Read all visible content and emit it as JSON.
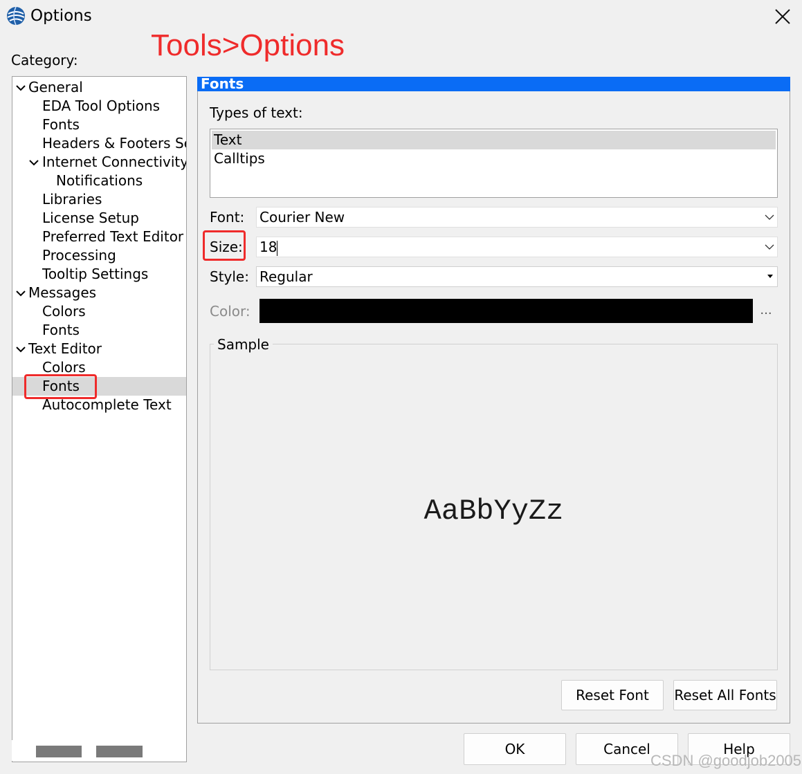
{
  "window": {
    "title": "Options",
    "icon": "app-globe-icon"
  },
  "annotation": {
    "title": "Tools>Options",
    "color": "#ef2b2b"
  },
  "category": {
    "label": "Category:",
    "items": [
      {
        "label": "General",
        "expanded": true
      },
      {
        "label": "EDA Tool Options"
      },
      {
        "label": "Fonts"
      },
      {
        "label": "Headers & Footers Set"
      },
      {
        "label": "Internet Connectivity",
        "expanded": true
      },
      {
        "label": "Notifications"
      },
      {
        "label": "Libraries"
      },
      {
        "label": "License Setup"
      },
      {
        "label": "Preferred Text Editor"
      },
      {
        "label": "Processing"
      },
      {
        "label": "Tooltip Settings"
      },
      {
        "label": "Messages",
        "expanded": true
      },
      {
        "label": "Colors"
      },
      {
        "label": "Fonts"
      },
      {
        "label": "Text Editor",
        "expanded": true
      },
      {
        "label": "Colors"
      },
      {
        "label": "Fonts",
        "selected": true
      },
      {
        "label": "Autocomplete Text"
      }
    ]
  },
  "panel": {
    "title": "Fonts",
    "header_color": "#0a6cf5",
    "types_label": "Types of text:",
    "types": [
      {
        "label": "Text",
        "selected": true
      },
      {
        "label": "Calltips"
      }
    ],
    "font_label": "Font:",
    "font_value": "Courier New",
    "size_label": "Size:",
    "size_value": "18",
    "style_label": "Style:",
    "style_value": "Regular",
    "color_label": "Color:",
    "color_value": "#000000",
    "color_button": "...",
    "sample_label": "Sample",
    "sample_text": "AaBbYyZz",
    "reset_font": "Reset Font",
    "reset_all_fonts": "Reset All Fonts"
  },
  "buttons": {
    "ok": "OK",
    "cancel": "Cancel",
    "help": "Help"
  },
  "watermark": "CSDN @goodjob2005"
}
